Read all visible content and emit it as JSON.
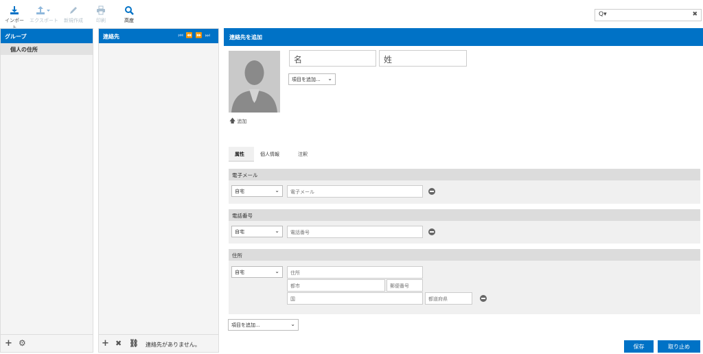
{
  "toolbar": {
    "import": "インポート",
    "export": "エクスポート",
    "compose": "新規作成",
    "print": "印刷",
    "advanced": "高度"
  },
  "search": {
    "placeholder": ""
  },
  "groups": {
    "header": "グループ",
    "items": [
      {
        "label": "個人の住所"
      }
    ]
  },
  "contacts": {
    "header": "連絡先",
    "empty_text": "連絡先がありません。"
  },
  "editor": {
    "header": "連絡先を追加",
    "first_name_placeholder": "名",
    "last_name_placeholder": "姓",
    "add_field_top": "項目を追加...",
    "add_photo": "追加",
    "tabs": [
      "属性",
      "個人情報",
      "注釈"
    ],
    "email": {
      "legend": "電子メール",
      "type": "自宅",
      "placeholder": "電子メール"
    },
    "phone": {
      "legend": "電話番号",
      "type": "自宅",
      "placeholder": "電話番号"
    },
    "address": {
      "legend": "住所",
      "type": "自宅",
      "street": "住所",
      "city": "都市",
      "zip": "郵便番号",
      "country": "国",
      "region": "都道府県"
    },
    "add_field_bottom": "項目を追加...",
    "save": "保存",
    "cancel": "取り止め"
  },
  "colors": {
    "accent": "#0072c6",
    "disabled": "#b8c4cc"
  }
}
